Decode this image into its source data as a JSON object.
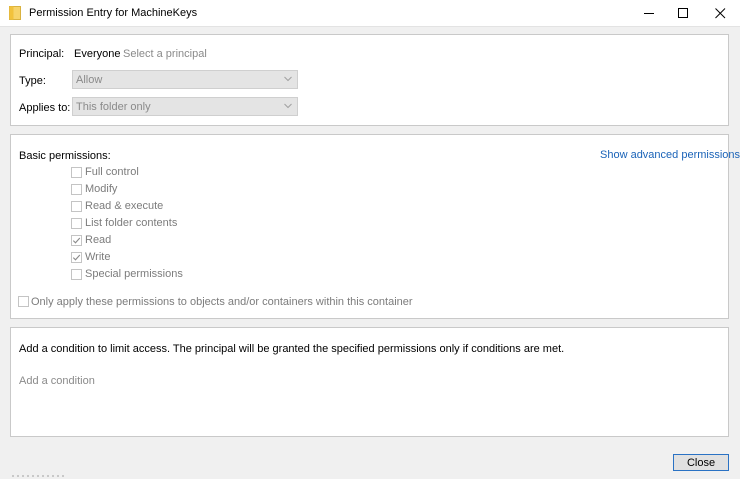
{
  "window": {
    "title": "Permission Entry for MachineKeys"
  },
  "principal": {
    "label": "Principal:",
    "value": "Everyone",
    "select_link": "Select a principal"
  },
  "type": {
    "label": "Type:",
    "value": "Allow"
  },
  "applies_to": {
    "label": "Applies to:",
    "value": "This folder only"
  },
  "permissions": {
    "heading": "Basic permissions:",
    "advanced_link": "Show advanced permissions",
    "items": [
      {
        "label": "Full control",
        "checked": false
      },
      {
        "label": "Modify",
        "checked": false
      },
      {
        "label": "Read & execute",
        "checked": false
      },
      {
        "label": "List folder contents",
        "checked": false
      },
      {
        "label": "Read",
        "checked": true
      },
      {
        "label": "Write",
        "checked": true
      },
      {
        "label": "Special permissions",
        "checked": false
      }
    ],
    "only_apply_label": "Only apply these permissions to objects and/or containers within this container",
    "only_apply_checked": false
  },
  "condition": {
    "description": "Add a condition to limit access. The principal will be granted the specified permissions only if conditions are met.",
    "add_link": "Add a condition"
  },
  "footer": {
    "close_label": "Close"
  },
  "colors": {
    "link": "#1a63b8",
    "disabled_text": "#8a8a8a",
    "folder_icon": "#f7d46b",
    "button_focus_border": "#2a72c4"
  }
}
